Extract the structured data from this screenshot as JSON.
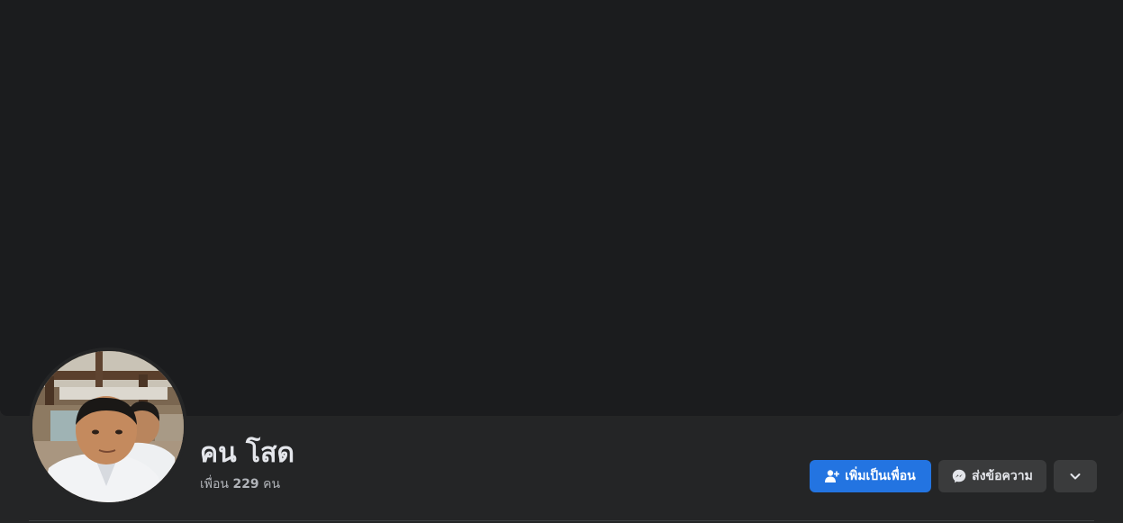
{
  "profile": {
    "name": "คน โสด",
    "friends_label": "เพื่อน",
    "friends_count": "229",
    "friends_unit": "คน"
  },
  "actions": {
    "add_friend_label": "เพิ่มเป็นเพื่อน",
    "message_label": "ส่งข้อความ",
    "more_icon": "chevron-down-icon",
    "add_friend_icon": "add-friend-icon",
    "message_icon": "messenger-icon"
  },
  "colors": {
    "background": "#242526",
    "cover": "#1b1c1e",
    "primary_button": "#2374e1",
    "secondary_button": "#3a3b3c",
    "text_primary": "#e4e6eb",
    "text_secondary": "#b0b3b8"
  }
}
